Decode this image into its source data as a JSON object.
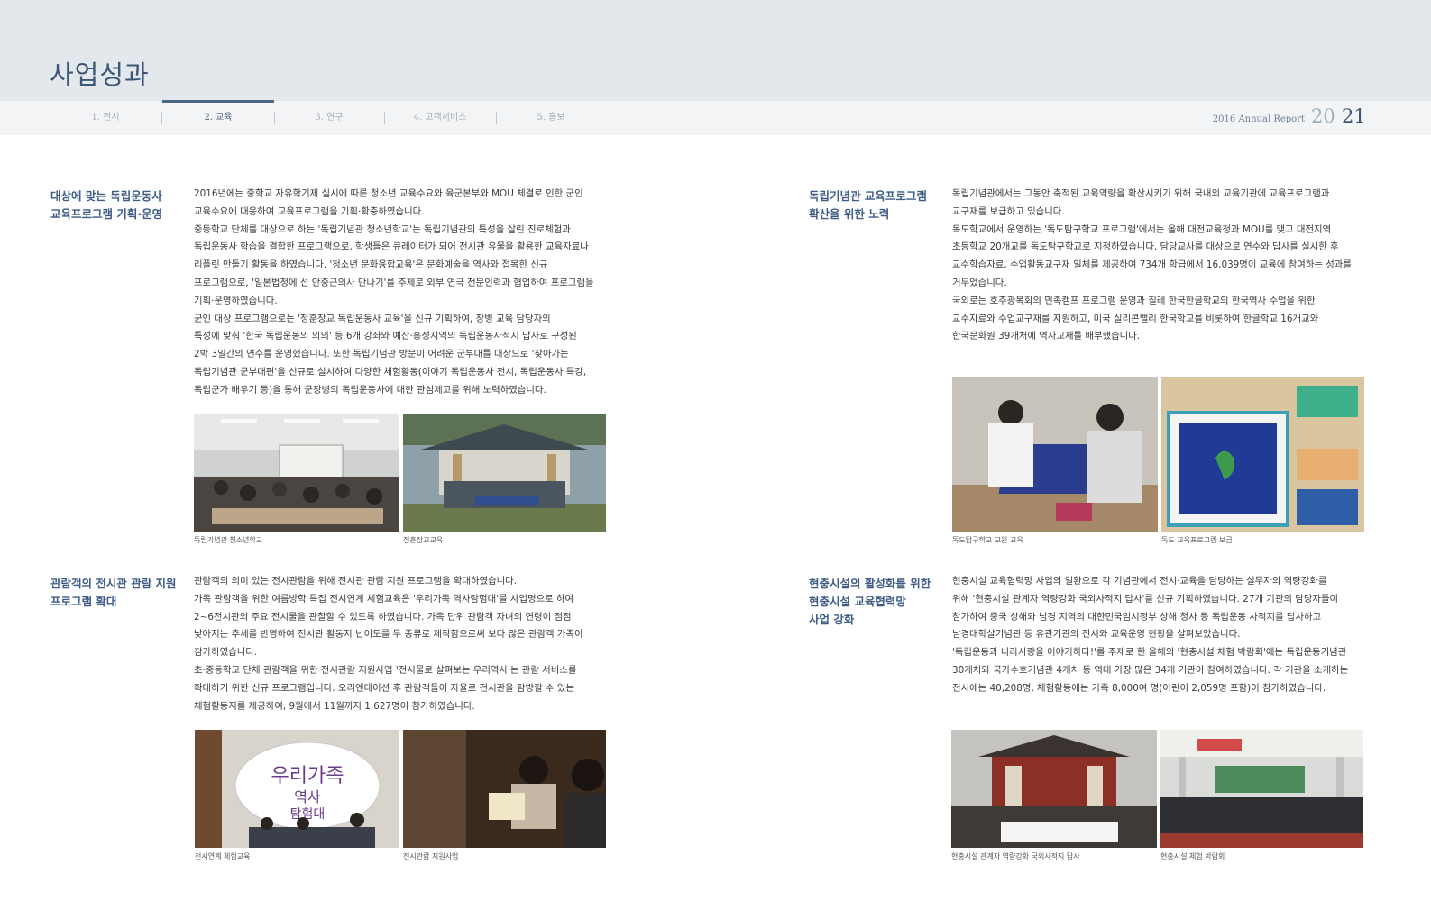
{
  "header": {
    "title": "사업성과",
    "tabs": [
      {
        "label": "1. 전시"
      },
      {
        "label": "2. 교육"
      },
      {
        "label": "3. 연구"
      },
      {
        "label": "4. 고객서비스"
      },
      {
        "label": "5. 홍보"
      }
    ],
    "active_tab": "2. 교육",
    "report_label": "2016 Annual Report",
    "page_left": "20",
    "page_right": "21"
  },
  "sections": [
    {
      "heading": [
        "대상에 맞는 독립운동사",
        "교육프로그램 기획·운영"
      ],
      "body": [
        "2016년에는 중학교 자유학기제 실시에 따른 청소년 교육수요와 육군본부와 MOU 체결로 인한 군인",
        "교육수요에 대응하여 교육프로그램을 기획·확충하였습니다.",
        "중등학교 단체를 대상으로 하는 '독립기념관 청소년학교'는 독립기념관의 특성을 살린 진로체험과",
        "독립운동사 학습을 결합한 프로그램으로, 학생들은 큐레이터가 되어 전시관 유물을 활용한 교육자료나",
        "리플릿 만들기 활동을 하였습니다. '청소년 문화융합교육'은 문화예술을 역사와 접목한 신규",
        "프로그램으로, '일본법정에 선 안중근의사 만나기'를 주제로 외부 연극 전문인력과 협업하여 프로그램을",
        "기획·운영하였습니다.",
        "군인 대상 프로그램으로는 '정훈장교 독립운동사 교육'을 신규 기획하여, 장병 교육 담당자의",
        "특성에 맞춰 '한국 독립운동의 의의' 등 6개 강좌와 예산·홍성지역의 독립운동사적지 답사로 구성된",
        "2박 3일간의 연수를 운영했습니다. 또한 독립기념관 방문이 어려운 군부대를 대상으로 '찾아가는",
        "독립기념관 군부대편'을 신규로 실시하여 다양한 체험활동(이야기 독립운동사 전시, 독립운동사 특강,",
        "독립군가 배우기 등)을 통해 군장병의 독립운동사에 대한 관심제고를 위해 노력하였습니다."
      ],
      "captions": [
        "독립기념관 청소년학교",
        "정훈장교교육"
      ]
    },
    {
      "heading": [
        "독립기념관 교육프로그램",
        "확산을 위한 노력"
      ],
      "body": [
        "독립기념관에서는 그동안 축적된 교육역량을 확산시키기 위해 국내외 교육기관에 교육프로그램과",
        "교구재를 보급하고 있습니다.",
        "독도학교에서 운영하는 '독도탐구학교 프로그램'에서는 올해 대전교육청과 MOU를 맺고 대전지역",
        "초등학교 20개교를 독도탐구학교로 지정하였습니다. 담당교사를 대상으로 연수와 답사를 실시한 후",
        "교수학습자료, 수업활동교구재 일체를 제공하여 734개 학급에서 16,039명이 교육에 참여하는 성과를",
        "거두었습니다.",
        "국외로는 호주광복회의 민족캠프 프로그램 운영과 칠레 한국한글학교의 한국역사 수업을 위한",
        "교수자료와 수업교구재를 지원하고, 미국 실리콘밸리 한국학교를 비롯하여 한글학교 16개교와",
        "한국문화원 39개처에 역사교재를 배부했습니다."
      ],
      "captions": [
        "독도탐구학교 교원 교육",
        "독도 교육프로그램 보급"
      ]
    },
    {
      "heading": [
        "관람객의 전시관 관람 지원",
        "프로그램 확대"
      ],
      "body": [
        "관람객의 의미 있는 전시관람을 위해 전시관 관람 지원 프로그램을 확대하였습니다.",
        "가족 관람객을 위한 여름방학 특집 전시연계 체험교육은 '우리가족 역사탐험대'를 사업명으로 하여",
        "2~6전시관의 주요 전시물을 관찰할 수 있도록 하였습니다. 가족 단위 관람객 자녀의 연령이 점점",
        "낮아지는 추세를 반영하여 전시관 활동지 난이도를 두 종류로 제작함으로써 보다 많은 관람객 가족이",
        "참가하였습니다.",
        "초·중등학교 단체 관람객을 위한 전시관람 지원사업 '전시물로 살펴보는 우리역사'는 관람 서비스를",
        "확대하기 위한 신규 프로그램입니다. 오리엔테이션 후 관람객들이 자율로 전시관을 탐방할 수 있는",
        "체험활동지를 제공하여, 9월에서 11월까지 1,627명이 참가하였습니다."
      ],
      "captions": [
        "전시연계 체험교육",
        "전시관람 지원사업"
      ],
      "photo_text": {
        "line1": "우리가족",
        "line2": "역사",
        "line3": "탐험대"
      }
    },
    {
      "heading": [
        "현충시설의 활성화를 위한",
        "현충시설 교육협력망",
        "사업 강화"
      ],
      "body": [
        "현충시설 교육협력망 사업의 일환으로 각 기념관에서 전시·교육을 담당하는 실무자의 역량강화를",
        "위해 '현충시설 관계자 역량강화 국외사적지 답사'를 신규 기획하였습니다. 27개 기관의 담당자들이",
        "참가하여 중국 상해와 남경 지역의 대한민국임시정부 상해 청사 등 독립운동 사적지를 답사하고",
        "남경대학살기념관 등 유관기관의 전시와 교육운영 현황을 살펴보았습니다.",
        "'독립운동과 나라사랑을 이야기하다!'를 주제로 한 올해의 '현충시설 체험 박람회'에는 독립운동기념관",
        "30개처와 국가수호기념관 4개처 등 역대 가장 많은 34개 기관이 참여하였습니다. 각 기관을 소개하는",
        "전시에는 40,208명, 체험활동에는 가족 8,000여 명(어린이 2,059명 포함)이 참가하였습니다."
      ],
      "captions": [
        "현충시설 관계자 역량강화 국외사적지 답사",
        "현충시설 체험 박람회"
      ]
    }
  ],
  "colors": {
    "heading": "#3e5c86",
    "band": "#e3e8ed",
    "tabbar": "#f3f4f5",
    "accent": "#4e6584"
  }
}
